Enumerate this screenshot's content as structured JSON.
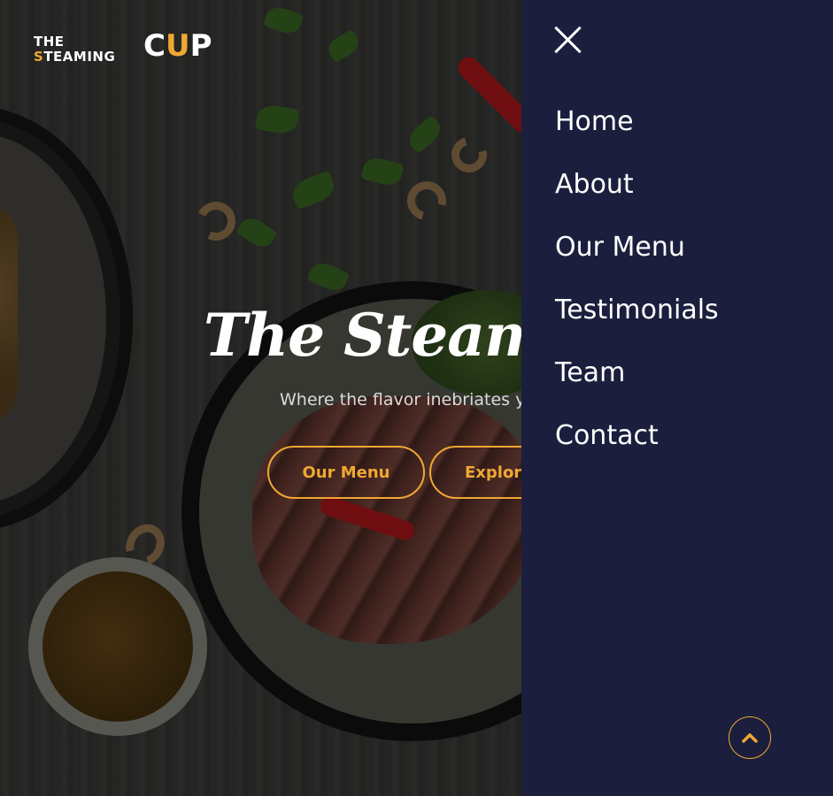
{
  "logo": {
    "line1": "THE",
    "line2_first": "S",
    "line2_rest": "TEAMING",
    "big_c": "C",
    "big_cup": "U",
    "big_p": "P"
  },
  "hero": {
    "title": "The Steaming Cup",
    "subtitle": "Where the flavor inebriates you",
    "buttons": [
      {
        "label": "Our Menu"
      },
      {
        "label": "Explore"
      }
    ]
  },
  "drawer": {
    "close_icon": "close-icon",
    "nav": [
      {
        "label": "Home"
      },
      {
        "label": "About"
      },
      {
        "label": "Our Menu"
      },
      {
        "label": "Testimonials"
      },
      {
        "label": "Team"
      },
      {
        "label": "Contact"
      }
    ],
    "scroll_icon": "chevron-up-icon"
  },
  "colors": {
    "accent": "#f0a733",
    "drawer_bg": "#1b1f3d",
    "text": "#ffffff"
  }
}
